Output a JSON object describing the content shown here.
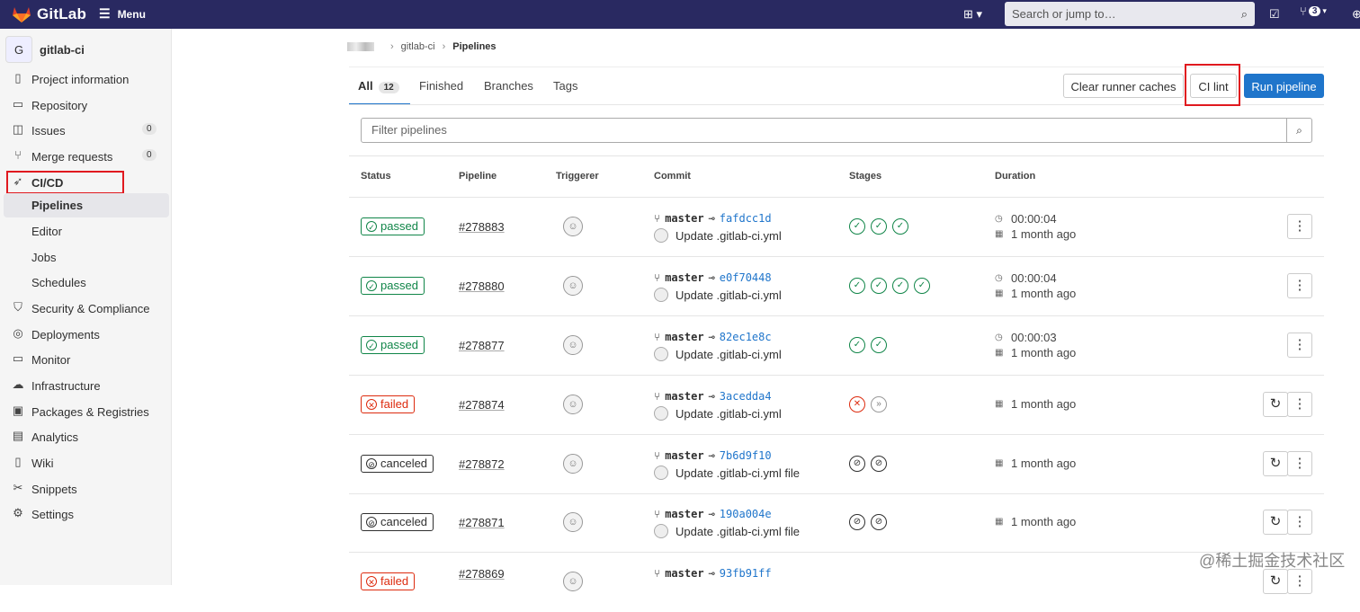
{
  "app": {
    "name": "GitLab",
    "menu_label": "Menu"
  },
  "search": {
    "placeholder": "Search or jump to…"
  },
  "header": {
    "mr_count": "3"
  },
  "project": {
    "initial": "G",
    "name": "gitlab-ci"
  },
  "sidebar": {
    "items": [
      {
        "label": "Project information",
        "icon": "info-icon"
      },
      {
        "label": "Repository",
        "icon": "doc-icon"
      },
      {
        "label": "Issues",
        "icon": "issues-icon",
        "count": "0"
      },
      {
        "label": "Merge requests",
        "icon": "merge-icon",
        "count": "0"
      },
      {
        "label": "CI/CD",
        "icon": "rocket-icon"
      },
      {
        "label": "Security & Compliance",
        "icon": "shield-icon"
      },
      {
        "label": "Deployments",
        "icon": "deploy-icon"
      },
      {
        "label": "Monitor",
        "icon": "monitor-icon"
      },
      {
        "label": "Infrastructure",
        "icon": "cloud-icon"
      },
      {
        "label": "Packages & Registries",
        "icon": "package-icon"
      },
      {
        "label": "Analytics",
        "icon": "chart-icon"
      },
      {
        "label": "Wiki",
        "icon": "book-icon"
      },
      {
        "label": "Snippets",
        "icon": "scissors-icon"
      },
      {
        "label": "Settings",
        "icon": "gear-icon"
      }
    ],
    "cicd_sub": [
      "Pipelines",
      "Editor",
      "Jobs",
      "Schedules"
    ]
  },
  "breadcrumb": {
    "project": "gitlab-ci",
    "current": "Pipelines"
  },
  "tabs": {
    "all": "All",
    "all_count": "12",
    "finished": "Finished",
    "branches": "Branches",
    "tags": "Tags"
  },
  "buttons": {
    "clear_cache": "Clear runner caches",
    "ci_lint": "CI lint",
    "run": "Run pipeline"
  },
  "filter": {
    "placeholder": "Filter pipelines"
  },
  "columns": {
    "status": "Status",
    "pipeline": "Pipeline",
    "triggerer": "Triggerer",
    "commit": "Commit",
    "stages": "Stages",
    "duration": "Duration"
  },
  "rows": [
    {
      "status": "passed",
      "id": "#278883",
      "branch": "master",
      "sha": "fafdcc1d",
      "msg": "Update .gitlab-ci.yml",
      "stages": [
        "success",
        "success",
        "success"
      ],
      "duration": "00:00:04",
      "ago": "1 month ago"
    },
    {
      "status": "passed",
      "id": "#278880",
      "branch": "master",
      "sha": "e0f70448",
      "msg": "Update .gitlab-ci.yml",
      "stages": [
        "success",
        "success",
        "success",
        "success"
      ],
      "duration": "00:00:04",
      "ago": "1 month ago"
    },
    {
      "status": "passed",
      "id": "#278877",
      "branch": "master",
      "sha": "82ec1e8c",
      "msg": "Update .gitlab-ci.yml",
      "stages": [
        "success",
        "success"
      ],
      "duration": "00:00:03",
      "ago": "1 month ago"
    },
    {
      "status": "failed",
      "id": "#278874",
      "branch": "master",
      "sha": "3acedda4",
      "msg": "Update .gitlab-ci.yml",
      "stages": [
        "failed",
        "skipped"
      ],
      "duration": "",
      "ago": "1 month ago"
    },
    {
      "status": "canceled",
      "id": "#278872",
      "branch": "master",
      "sha": "7b6d9f10",
      "msg": "Update .gitlab-ci.yml file",
      "stages": [
        "canceled",
        "canceled"
      ],
      "duration": "",
      "ago": "1 month ago"
    },
    {
      "status": "canceled",
      "id": "#278871",
      "branch": "master",
      "sha": "190a004e",
      "msg": "Update .gitlab-ci.yml file",
      "stages": [
        "canceled",
        "canceled"
      ],
      "duration": "",
      "ago": "1 month ago"
    },
    {
      "status": "failed",
      "id": "#278869",
      "branch": "master",
      "sha": "93fb91ff",
      "msg": "",
      "stages": [],
      "duration": "",
      "ago": ""
    }
  ],
  "watermark": "@稀土掘金技术社区",
  "colors": {
    "topbar": "#292961",
    "primary": "#1f75cb",
    "success": "#108548",
    "danger": "#dd2b0e",
    "highlight": "#e0191f"
  }
}
